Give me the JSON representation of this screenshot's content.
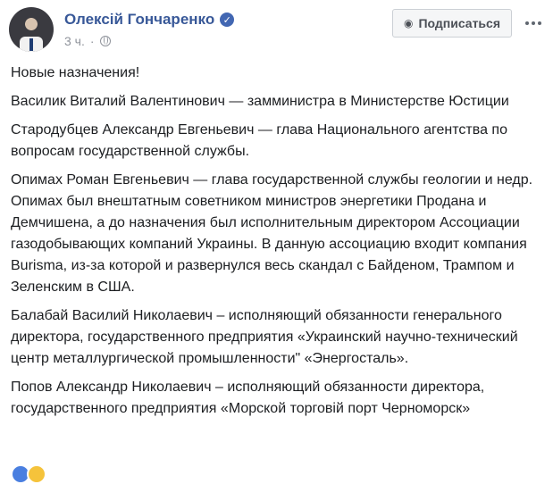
{
  "post": {
    "author": "Олексій Гончаренко",
    "time": "3 ч.",
    "subscribe_label": "Подписаться",
    "paragraphs": [
      "Новые назначения!",
      "Василик Виталий Валентинович — замминистра в Министерстве Юстиции",
      "Стародубцев Александр Евгеньевич — глава Национального агентства по вопросам государственной службы.",
      "Опимах Роман Евгеньевич — глава государственной службы геологии и недр. Опимах был внештатным советником министров энергетики Продана и Демчишена, а до назначения был исполнительным директором Ассоциации газодобывающих компаний Украины. В данную ассоциацию входит компания Burisma, из-за которой и развернулся весь скандал с Байденом, Трампом и Зеленским в США.",
      "Балабай Василий Николаевич – исполняющий обязанности генерального директора, государственного предприятия «Украинский научно-технический центр металлургической промышленности\" «Энергосталь».",
      "Попов Александр Николаевич – исполняющий обязанности директора, государственного предприятия «Морской торговій порт Черноморск»"
    ]
  },
  "icons": {
    "verified": "verified-badge-icon",
    "privacy": "globe-icon",
    "subscribe": "rss-icon",
    "more": "more-options-icon"
  },
  "colors": {
    "author": "#385898",
    "meta": "#90949c",
    "verified": "#4267b2"
  }
}
